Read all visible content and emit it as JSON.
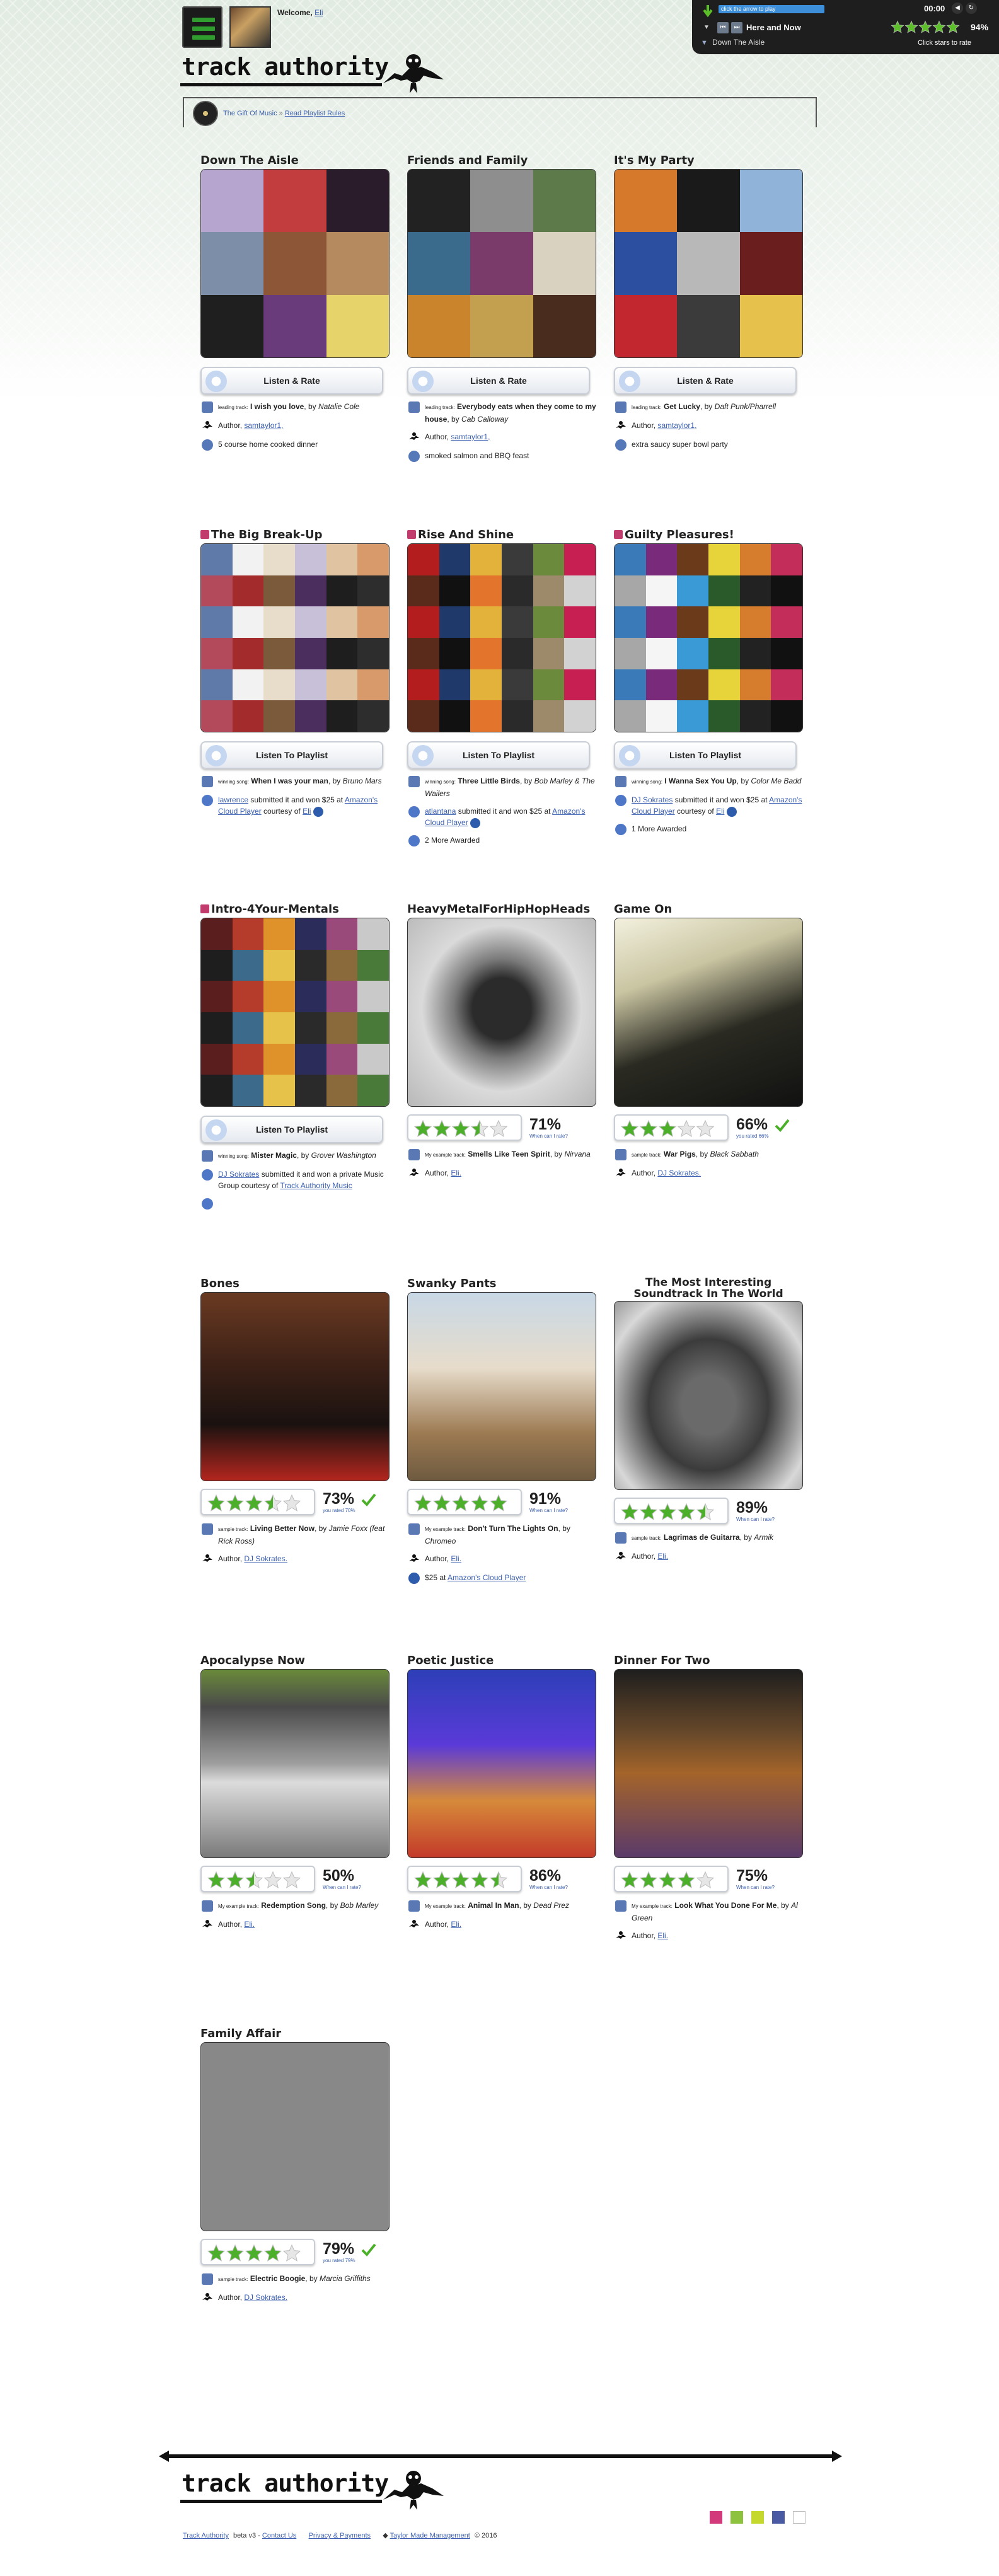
{
  "header": {
    "welcome_label": "Welcome,",
    "user_link": "Eli",
    "logo_text": "track authority"
  },
  "player": {
    "instruction": "click the arrow to play",
    "time": "00:00",
    "now_playing": "Here and Now",
    "rating_percent": "94%",
    "rating_stars": 5,
    "hint": "Click stars to rate",
    "playlist": "Down The Aisle",
    "color_accent": "#5cbf2a"
  },
  "breadcrumb": {
    "home": "The Gift Of Music",
    "separator": "»",
    "current": "Read Playlist Rules"
  },
  "cards": [
    {
      "title": "Down The Aisle",
      "tag": false,
      "button": "Listen & Rate",
      "row1_prefix": "leading track:",
      "row1_track": "I wish you love",
      "row1_by": ", by ",
      "row1_artist": "Natalie Cole",
      "row2_label": "Author,",
      "row2_link": "samtaylor1,",
      "row3_text": "5 course home cooked dinner"
    },
    {
      "title": "Friends and Family",
      "tag": false,
      "button": "Listen & Rate",
      "row1_prefix": "leading track:",
      "row1_track": "Everybody eats when they come to my house",
      "row1_by": ", by ",
      "row1_artist": "Cab Calloway",
      "row2_label": "Author,",
      "row2_link": "samtaylor1,",
      "row3_text": "smoked salmon and BBQ feast"
    },
    {
      "title": "It's My Party",
      "tag": false,
      "button": "Listen & Rate",
      "row1_prefix": "leading track:",
      "row1_track": "Get Lucky",
      "row1_by": ", by ",
      "row1_artist": "Daft Punk/Pharrell",
      "row2_label": "Author,",
      "row2_link": "samtaylor1,",
      "row3_text": "extra saucy super bowl party"
    },
    {
      "title": "The Big Break-Up",
      "tag": true,
      "button": "Listen To Playlist",
      "row1_prefix": "winning song:",
      "row1_track": "When I was your man",
      "row1_by": ", by ",
      "row1_artist": "Bruno Mars",
      "row2_link": "lawrence",
      "row2_text": "submitted it and won $25 at",
      "row2_link2": "Amazon's Cloud Player",
      "row2_text2": "courtesy of",
      "row2_link3": "Eli",
      "row3_text": ""
    },
    {
      "title": "Rise And Shine",
      "tag": true,
      "button": "Listen To Playlist",
      "row1_prefix": "winning song:",
      "row1_track": "Three Little Birds",
      "row1_by": ", by ",
      "row1_artist": "Bob Marley & The Wailers",
      "row2_link": "atlantana",
      "row2_text": "submitted it and won $25 at",
      "row2_link2": "Amazon's Cloud Player",
      "row2_text2": "",
      "row2_link3": "",
      "row3_text": "2 More Awarded"
    },
    {
      "title": "Guilty Pleasures!",
      "tag": true,
      "button": "Listen To Playlist",
      "row1_prefix": "winning song:",
      "row1_track": "I Wanna Sex You Up",
      "row1_by": ", by ",
      "row1_artist": "Color Me Badd",
      "row2_link": "DJ Sokrates",
      "row2_text": "submitted it and won $25 at",
      "row2_link2": "Amazon's Cloud Player",
      "row2_text2": "courtesy of",
      "row2_link3": "Eli",
      "row3_text": "1 More Awarded"
    },
    {
      "title": "Intro-4Your-Mentals",
      "tag": true,
      "button": "Listen To Playlist",
      "row1_prefix": "winning song:",
      "row1_track": "Mister Magic",
      "row1_by": ", by ",
      "row1_artist": "Grover Washington",
      "row2_link": "DJ Sokrates",
      "row2_text": "submitted it and won a private Music Group courtesy of",
      "row2_link2": "Track Authority Music",
      "row2_text2": "",
      "row2_link3": "",
      "row3_text": ""
    },
    {
      "title": "HeavyMetalForHipHopHeads",
      "tag": false,
      "rating": "71%",
      "stars": 3.5,
      "rated": false,
      "sub": "When can I rate?",
      "row1_prefix": "My example track:",
      "row1_track": "Smells Like Teen Spirit",
      "row1_by": ", by ",
      "row1_artist": "Nirvana",
      "row2_label": "Author,",
      "row2_link": "Eli."
    },
    {
      "title": "Game On",
      "tag": false,
      "rating": "66%",
      "stars": 3,
      "rated": true,
      "sub": "you rated 66%",
      "row1_prefix": "sample track:",
      "row1_track": "War Pigs",
      "row1_by": ", by ",
      "row1_artist": "Black Sabbath",
      "row2_label": "Author,",
      "row2_link": "DJ Sokrates."
    },
    {
      "title": "Bones",
      "tag": false,
      "rating": "73%",
      "stars": 3.5,
      "rated": true,
      "sub": "you rated 70%",
      "row1_prefix": "sample track:",
      "row1_track": "Living Better Now",
      "row1_by": ", by ",
      "row1_artist": "Jamie Foxx (feat Rick Ross)",
      "row2_label": "Author,",
      "row2_link": "DJ Sokrates."
    },
    {
      "title": "Swanky Pants",
      "tag": false,
      "rating": "91%",
      "stars": 5,
      "rated": false,
      "sub": "When can I rate?",
      "row1_prefix": "My example track:",
      "row1_track": "Don't Turn The Lights On",
      "row1_by": ", by ",
      "row1_artist": "Chromeo",
      "row2_label": "Author,",
      "row2_link": "Eli.",
      "row3_prefix": "$25 at",
      "row3_link": "Amazon's Cloud Player"
    },
    {
      "title": "The Most Interesting Soundtrack In The World",
      "tag": false,
      "rating": "89%",
      "stars": 4.5,
      "rated": false,
      "sub": "When can I rate?",
      "row1_prefix": "sample track:",
      "row1_track": "Lagrimas de Guitarra",
      "row1_by": ", by ",
      "row1_artist": "Armik",
      "row2_label": "Author,",
      "row2_link": "Eli."
    },
    {
      "title": "Apocalypse Now",
      "tag": false,
      "rating": "50%",
      "stars": 2.5,
      "rated": false,
      "sub": "When can I rate?",
      "row1_prefix": "My example track:",
      "row1_track": "Redemption Song",
      "row1_by": ", by ",
      "row1_artist": "Bob Marley",
      "row2_label": "Author,",
      "row2_link": "Eli."
    },
    {
      "title": "Poetic Justice",
      "tag": false,
      "rating": "86%",
      "stars": 4.5,
      "rated": false,
      "sub": "When can I rate?",
      "row1_prefix": "My example track:",
      "row1_track": "Animal In Man",
      "row1_by": ", by ",
      "row1_artist": "Dead Prez",
      "row2_label": "Author,",
      "row2_link": "Eli."
    },
    {
      "title": "Dinner For Two",
      "tag": false,
      "rating": "75%",
      "stars": 4,
      "rated": false,
      "sub": "When can I rate?",
      "row1_prefix": "My example track:",
      "row1_track": "Look What You Done For Me",
      "row1_by": ", by ",
      "row1_artist": "Al Green",
      "row2_label": "Author,",
      "row2_link": "Eli."
    },
    {
      "title": "Family Affair",
      "tag": false,
      "rating": "79%",
      "stars": 4,
      "rated": true,
      "sub": "you rated 79%",
      "row1_prefix": "sample track:",
      "row1_track": "Electric Boogie",
      "row1_by": ", by ",
      "row1_artist": "Marcia Griffiths",
      "row2_label": "Author,",
      "row2_link": "DJ Sokrates."
    }
  ],
  "footer": {
    "brand_link": "Track Authority",
    "version": "beta v3 -",
    "contact": "Contact Us",
    "privacy": "Privacy & Payments",
    "maker": "Taylor Made Management",
    "year": "© 2016",
    "swatches": [
      "#d23a7b",
      "#8dc23f",
      "#c4d82e",
      "#4a5ba4",
      "#ffffff"
    ]
  },
  "colors": {
    "star_on": "#4caf2a",
    "star_off": "#e6e6e6",
    "link": "#3a5fb0"
  }
}
